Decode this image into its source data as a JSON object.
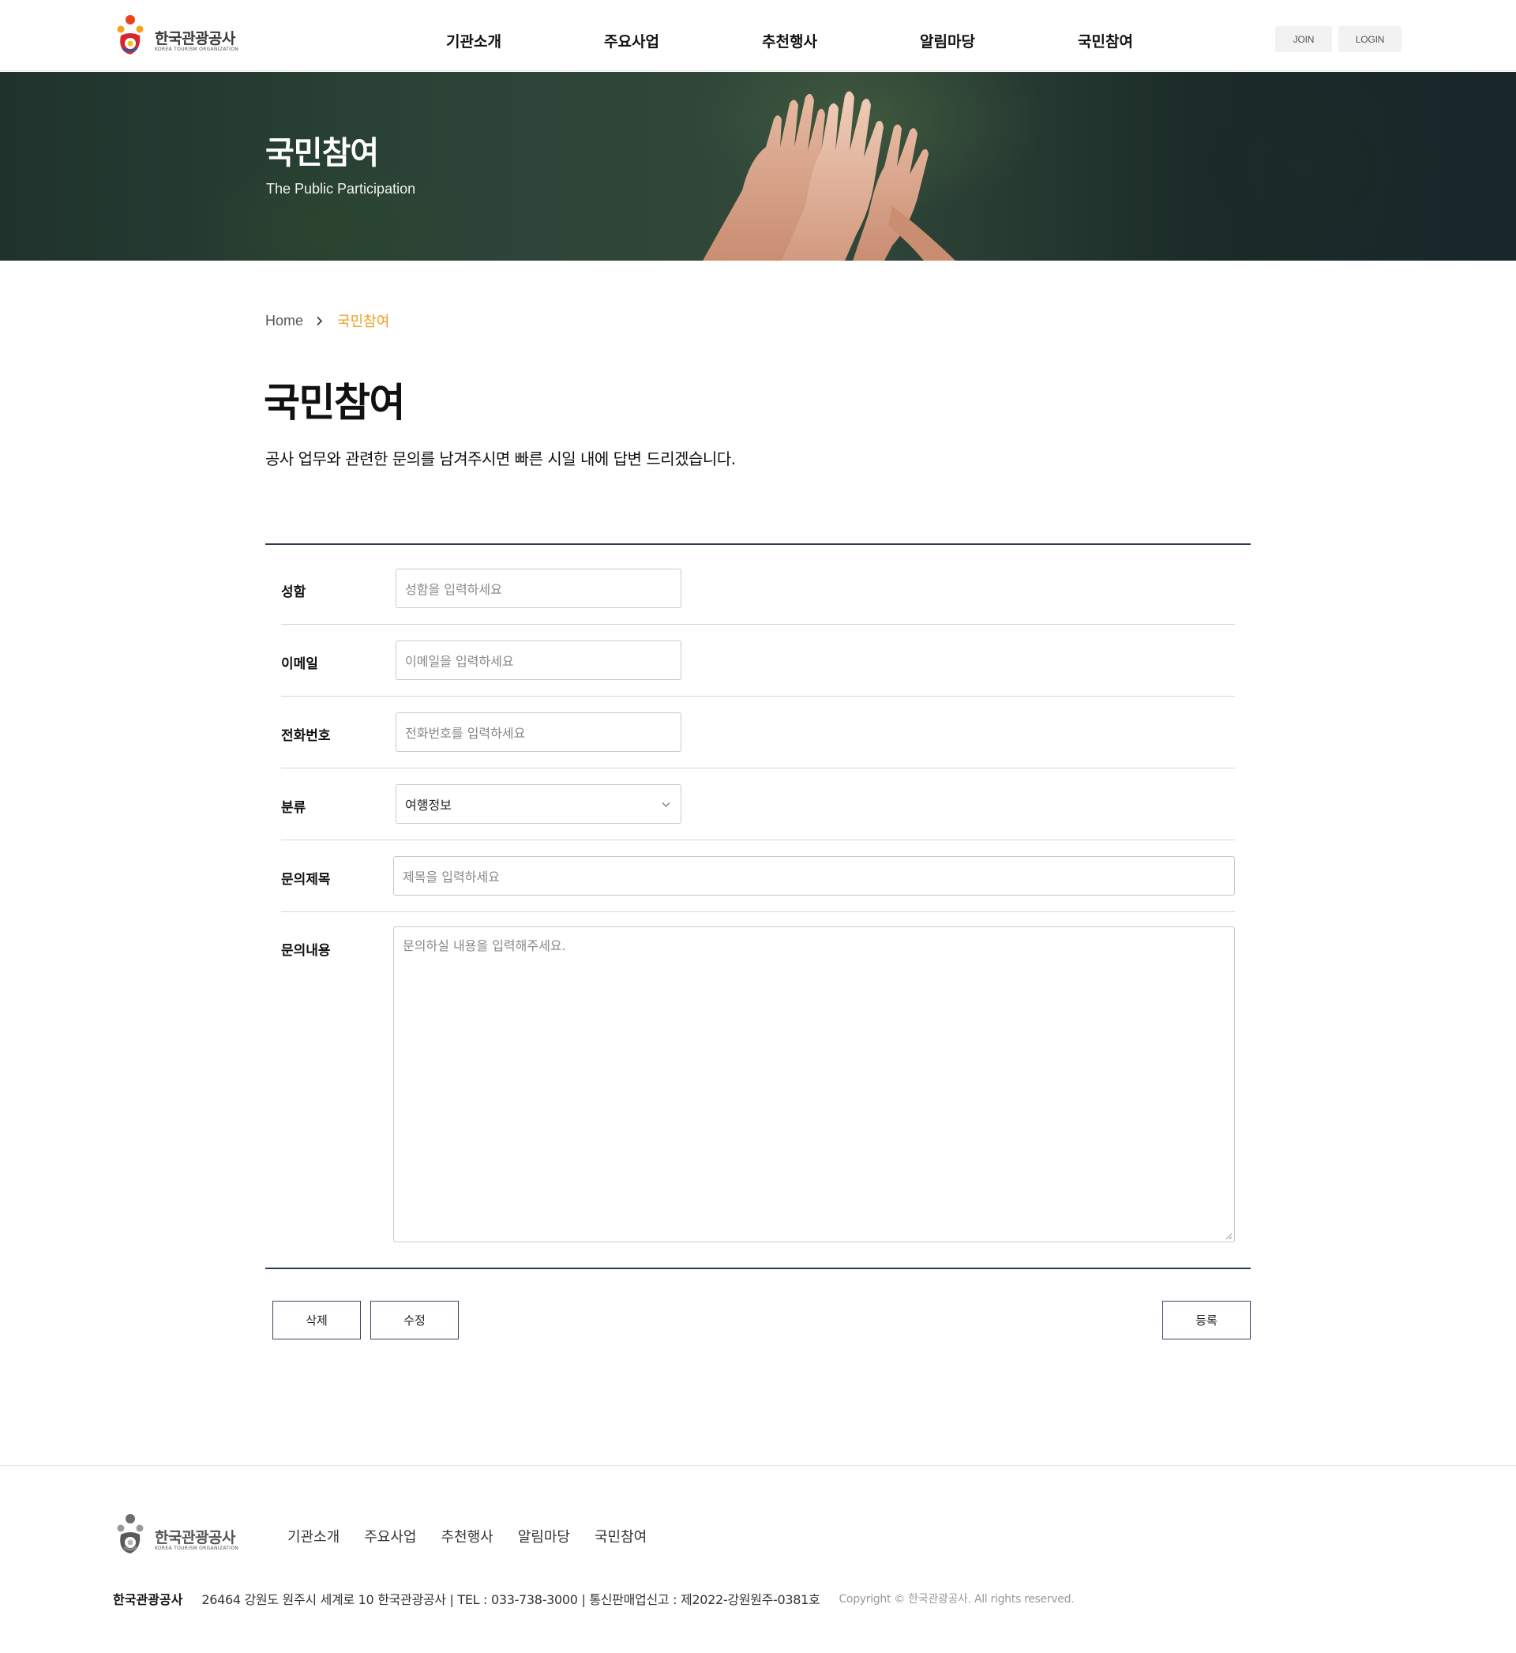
{
  "header": {
    "logo_text": "한국관광공사",
    "logo_sub": "KOREA TOURISM ORGANIZATION",
    "nav": [
      "기관소개",
      "주요사업",
      "추천행사",
      "알림마당",
      "국민참여"
    ],
    "join": "JOIN",
    "login": "LOGIN"
  },
  "hero": {
    "title": "국민참여",
    "subtitle": "The Public Participation"
  },
  "breadcrumb": {
    "home": "Home",
    "current": "국민참여"
  },
  "page": {
    "title": "국민참여",
    "description": "공사 업무와 관련한 문의를 남겨주시면 빠른 시일 내에 답변 드리겠습니다."
  },
  "form": {
    "name": {
      "label": "성함",
      "placeholder": "성함을 입력하세요"
    },
    "email": {
      "label": "이메일",
      "placeholder": "이메일을 입력하세요"
    },
    "phone": {
      "label": "전화번호",
      "placeholder": "전화번호를 입력하세요"
    },
    "category": {
      "label": "분류",
      "value": "여행정보"
    },
    "subject": {
      "label": "문의제목",
      "placeholder": "제목을 입력하세요"
    },
    "content": {
      "label": "문의내용",
      "placeholder": "문의하실 내용을 입력해주세요."
    }
  },
  "actions": {
    "delete": "삭제",
    "edit": "수정",
    "submit": "등록"
  },
  "footer": {
    "logo_text": "한국관광공사",
    "logo_sub": "KOREA TOURISM ORGANIZATION",
    "nav": [
      "기관소개",
      "주요사업",
      "추천행사",
      "알림마당",
      "국민참여"
    ],
    "org_name": "한국관광공사",
    "address": "26464 강원도 원주시 세계로 10 한국관광공사 | TEL : 033-738-3000 | 통신판매업신고 : 제2022-강원원주-0381호",
    "copyright": "Copyright © 한국관광공사. All rights reserved."
  },
  "colors": {
    "accent": "#f0a020",
    "form_border": "#2b3a5a",
    "button_border": "#3b4663"
  }
}
